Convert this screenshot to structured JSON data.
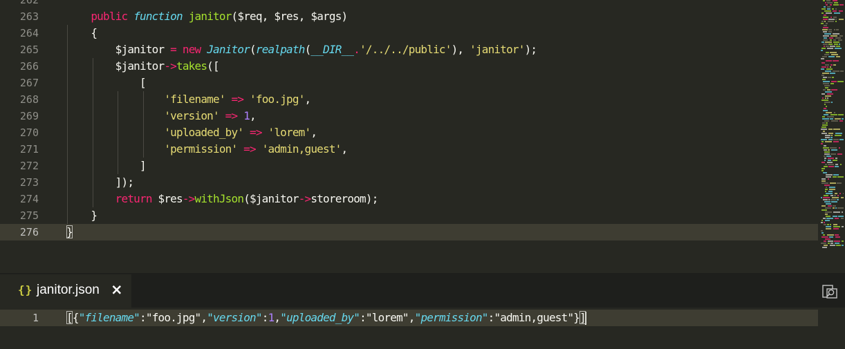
{
  "editor": {
    "top_partial_line": "262",
    "lines": [
      {
        "n": "263",
        "tokens": [
          {
            "t": "    "
          },
          {
            "t": "public",
            "c": "k"
          },
          {
            "t": " "
          },
          {
            "t": "function",
            "c": "t"
          },
          {
            "t": " "
          },
          {
            "t": "janitor",
            "c": "f"
          },
          {
            "t": "($req, $res, $args)"
          }
        ]
      },
      {
        "n": "264",
        "tokens": [
          {
            "t": "    {"
          }
        ]
      },
      {
        "n": "265",
        "tokens": [
          {
            "t": "        $janitor "
          },
          {
            "t": "=",
            "c": "k"
          },
          {
            "t": " "
          },
          {
            "t": "new",
            "c": "k"
          },
          {
            "t": " "
          },
          {
            "t": "Janitor",
            "c": "t"
          },
          {
            "t": "("
          },
          {
            "t": "realpath",
            "c": "t"
          },
          {
            "t": "("
          },
          {
            "t": "__DIR__",
            "c": "t"
          },
          {
            "t": ".",
            "c": "k"
          },
          {
            "t": "'/../../public'",
            "c": "s"
          },
          {
            "t": "), "
          },
          {
            "t": "'janitor'",
            "c": "s"
          },
          {
            "t": ");"
          }
        ]
      },
      {
        "n": "266",
        "tokens": [
          {
            "t": "        $janitor"
          },
          {
            "t": "->",
            "c": "k"
          },
          {
            "t": "takes",
            "c": "f"
          },
          {
            "t": "(["
          }
        ]
      },
      {
        "n": "267",
        "tokens": [
          {
            "t": "            ["
          }
        ]
      },
      {
        "n": "268",
        "tokens": [
          {
            "t": "                "
          },
          {
            "t": "'filename'",
            "c": "s"
          },
          {
            "t": " "
          },
          {
            "t": "=>",
            "c": "k"
          },
          {
            "t": " "
          },
          {
            "t": "'foo.jpg'",
            "c": "s"
          },
          {
            "t": ","
          }
        ]
      },
      {
        "n": "269",
        "tokens": [
          {
            "t": "                "
          },
          {
            "t": "'version'",
            "c": "s"
          },
          {
            "t": " "
          },
          {
            "t": "=>",
            "c": "k"
          },
          {
            "t": " "
          },
          {
            "t": "1",
            "c": "c"
          },
          {
            "t": ","
          }
        ]
      },
      {
        "n": "270",
        "tokens": [
          {
            "t": "                "
          },
          {
            "t": "'uploaded_by'",
            "c": "s"
          },
          {
            "t": " "
          },
          {
            "t": "=>",
            "c": "k"
          },
          {
            "t": " "
          },
          {
            "t": "'lorem'",
            "c": "s"
          },
          {
            "t": ","
          }
        ]
      },
      {
        "n": "271",
        "tokens": [
          {
            "t": "                "
          },
          {
            "t": "'permission'",
            "c": "s"
          },
          {
            "t": " "
          },
          {
            "t": "=>",
            "c": "k"
          },
          {
            "t": " "
          },
          {
            "t": "'admin,guest'",
            "c": "s"
          },
          {
            "t": ","
          }
        ]
      },
      {
        "n": "272",
        "tokens": [
          {
            "t": "            ]"
          }
        ]
      },
      {
        "n": "273",
        "tokens": [
          {
            "t": "        ]);"
          }
        ]
      },
      {
        "n": "274",
        "tokens": [
          {
            "t": "        "
          },
          {
            "t": "return",
            "c": "k"
          },
          {
            "t": " $res"
          },
          {
            "t": "->",
            "c": "k"
          },
          {
            "t": "withJson",
            "c": "f"
          },
          {
            "t": "($janitor"
          },
          {
            "t": "->",
            "c": "k"
          },
          {
            "t": "storeroom);"
          }
        ]
      },
      {
        "n": "275",
        "tokens": [
          {
            "t": "    }"
          }
        ]
      },
      {
        "n": "276",
        "tokens": [
          {
            "t": "}",
            "box": true
          }
        ],
        "active": true
      }
    ]
  },
  "panel": {
    "tab_icon": "{}",
    "tab_label": "janitor.json",
    "close_icon": "×",
    "line_number": "1",
    "json_tokens": [
      {
        "t": "[",
        "box": true
      },
      {
        "t": "{"
      },
      {
        "t": "\"filename\"",
        "c": "t"
      },
      {
        "t": ":"
      },
      {
        "t": "\"foo.jpg\""
      },
      {
        "t": ","
      },
      {
        "t": "\"version\"",
        "c": "t"
      },
      {
        "t": ":"
      },
      {
        "t": "1",
        "c": "c"
      },
      {
        "t": ","
      },
      {
        "t": "\"uploaded_by\"",
        "c": "t"
      },
      {
        "t": ":"
      },
      {
        "t": "\"lorem\""
      },
      {
        "t": ","
      },
      {
        "t": "\"permission\"",
        "c": "t"
      },
      {
        "t": ":"
      },
      {
        "t": "\"admin,guest\""
      },
      {
        "t": "}"
      },
      {
        "t": "]",
        "box": true,
        "cursor": true
      }
    ]
  },
  "colors": {
    "background": "#272822",
    "keyword": "#f92672",
    "string": "#e6db74",
    "function": "#a6e22e",
    "type": "#66d9ef",
    "number": "#ae81ff",
    "json_icon": "#cbcb41"
  }
}
